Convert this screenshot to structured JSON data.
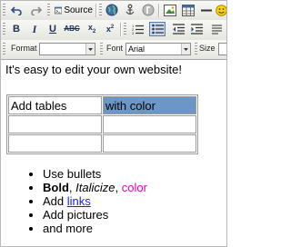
{
  "toolbar": {
    "source_label": "Source",
    "format_label": "Format",
    "font_label": "Font",
    "font_value": "Arial",
    "size_label": "Size"
  },
  "content": {
    "intro": "It's easy to edit your own website!",
    "table": [
      [
        "Add tables",
        "with color"
      ],
      [
        "",
        ""
      ],
      [
        "",
        ""
      ]
    ],
    "list": {
      "item1": "Use bullets",
      "item2_bold": "Bold",
      "item2_sep1": ", ",
      "item2_italic": "Italicize",
      "item2_sep2": ", ",
      "item2_color": "color",
      "item3_prefix": "Add ",
      "item3_link": "links",
      "item4": "Add pictures",
      "item5": "and more"
    }
  },
  "colors": {
    "selected_cell": "#6b97c8",
    "pink_text": "#e000c8",
    "link": "#1a1aee"
  }
}
